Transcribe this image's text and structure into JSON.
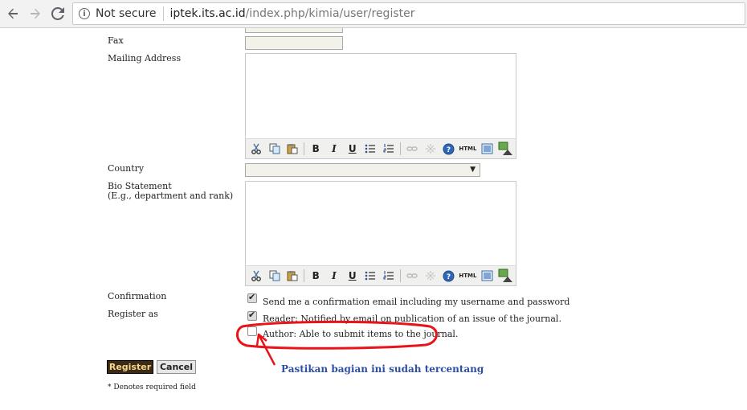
{
  "browser": {
    "security_label": "Not secure",
    "url_host": "iptek.its.ac.id",
    "url_path": "/index.php/kimia/user/register"
  },
  "form": {
    "fax_label": "Fax",
    "mailing_address_label": "Mailing Address",
    "country_label": "Country",
    "bio_label": "Bio Statement",
    "bio_sublabel": "(E.g., department and rank)",
    "confirmation_label": "Confirmation",
    "register_as_label": "Register as",
    "confirmation_option": "Send me a confirmation email including my username and password",
    "reader_option": "Reader: Notified by email on publication of an issue of the journal.",
    "author_option": "Author: Able to submit items to the journal.",
    "confirmation_checked": true,
    "reader_checked": true,
    "author_checked": false,
    "register_button": "Register",
    "cancel_button": "Cancel",
    "required_note": "* Denotes required field"
  },
  "toolbar": {
    "bold": "B",
    "italic": "I",
    "underline": "U",
    "html": "HTML"
  },
  "annotation": {
    "text": "Pastikan bagian ini sudah tercentang",
    "color": "#e8141a"
  }
}
